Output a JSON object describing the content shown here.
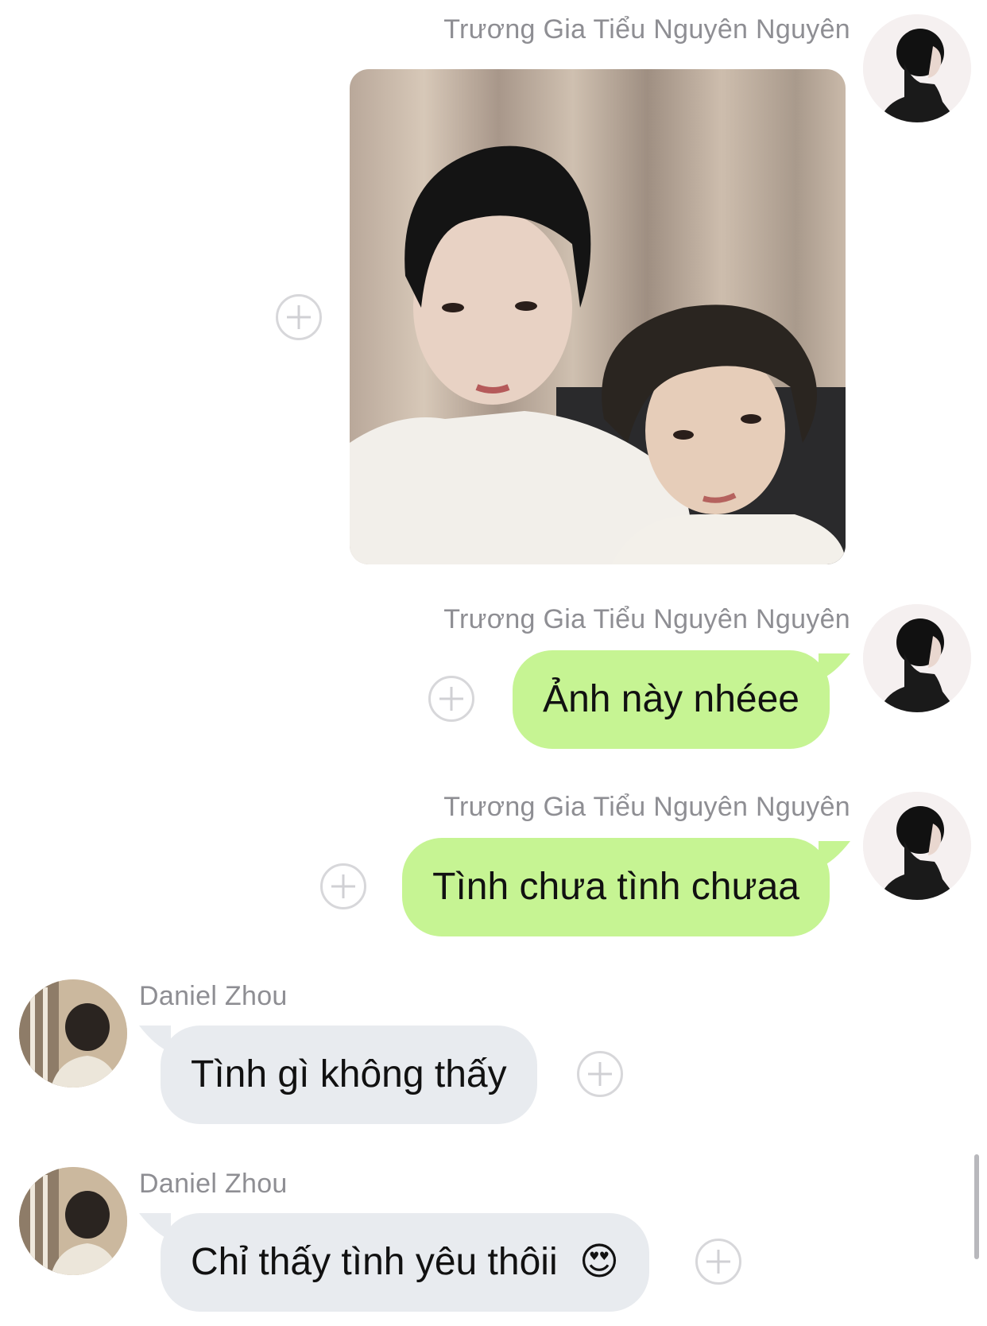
{
  "messages": [
    {
      "sender": "Trương Gia Tiểu Nguyên Nguyên",
      "type": "photo",
      "side": "right"
    },
    {
      "sender": "Trương Gia Tiểu Nguyên Nguyên",
      "type": "text",
      "side": "right",
      "text": "Ảnh này nhéee"
    },
    {
      "sender": "Trương Gia Tiểu Nguyên Nguyên",
      "type": "text",
      "side": "right",
      "text": "Tình chưa tình chưaa"
    },
    {
      "sender": "Daniel Zhou",
      "type": "text",
      "side": "left",
      "text": "Tình gì không thấy"
    },
    {
      "sender": "Daniel Zhou",
      "type": "text",
      "side": "left",
      "text": "Chỉ thấy tình yêu thôii",
      "emoji": "😍"
    }
  ],
  "colors": {
    "my_bubble": "#c6f493",
    "other_bubble": "#e8ebef",
    "sender_text": "#8e8e93",
    "background": "#ffffff"
  },
  "icons": [
    "add-reaction-icon",
    "avatar",
    "scrollbar"
  ]
}
